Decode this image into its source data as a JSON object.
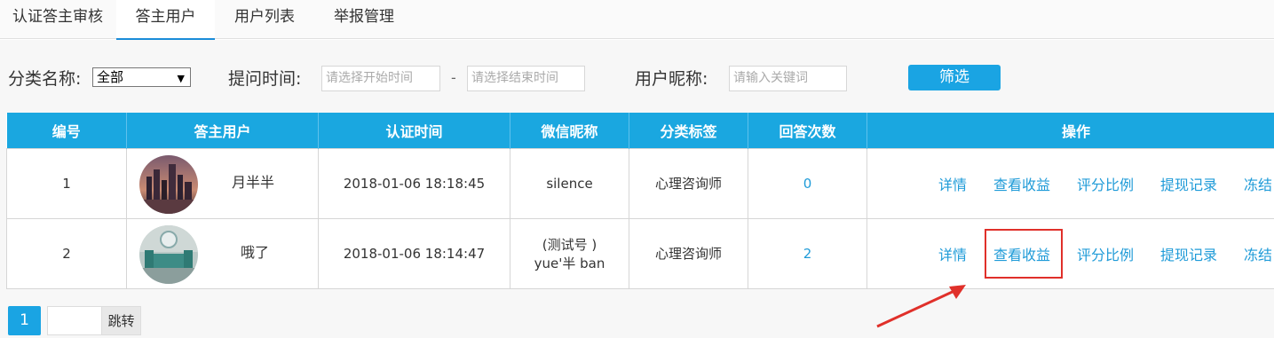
{
  "tabs": [
    {
      "label": "认证答主审核",
      "active": false
    },
    {
      "label": "答主用户",
      "active": true
    },
    {
      "label": "用户列表",
      "active": false
    },
    {
      "label": "举报管理",
      "active": false
    }
  ],
  "filters": {
    "category_label": "分类名称:",
    "category_value": "全部",
    "time_label": "提问时间:",
    "start_placeholder": "请选择开始时间",
    "dash": "-",
    "end_placeholder": "请选择结束时间",
    "nick_label": "用户昵称:",
    "nick_placeholder": "请输入关键词",
    "submit": "筛选"
  },
  "table": {
    "headers": [
      "编号",
      "答主用户",
      "认证时间",
      "微信昵称",
      "分类标签",
      "回答次数",
      "操作"
    ],
    "rows": [
      {
        "id": "1",
        "name": "月半半",
        "time": "2018-01-06 18:18:45",
        "wechat": "silence",
        "wechat2": "",
        "tag": "心理咨询师",
        "count": "0",
        "avatar": "city-avatar"
      },
      {
        "id": "2",
        "name": "哦了",
        "time": "2018-01-06 18:14:47",
        "wechat": "(测试号 )",
        "wechat2": "yue'半 ban",
        "tag": "心理咨询师",
        "count": "2",
        "avatar": "room-avatar"
      }
    ],
    "actions": [
      "详情",
      "查看收益",
      "评分比例",
      "提现记录",
      "冻结"
    ]
  },
  "pager": {
    "current": "1",
    "jump": "跳转"
  },
  "colors": {
    "primary": "#1aa7e0",
    "link": "#1f9bd8",
    "highlight": "#e0302a"
  }
}
